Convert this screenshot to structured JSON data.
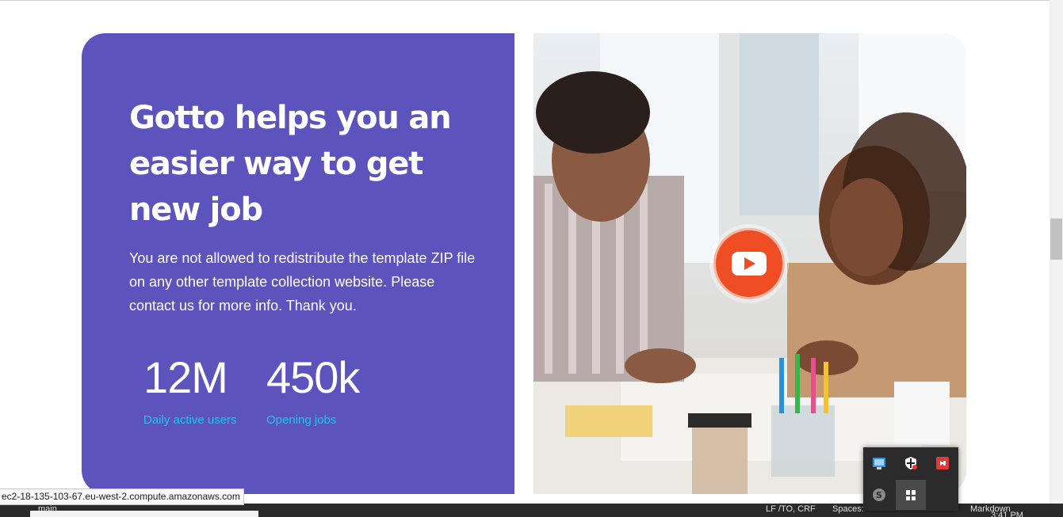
{
  "hero": {
    "title": "Gotto helps you an easier way to get new job",
    "description": "You are not allowed to redistribute the template ZIP file on any other template collection website. Please contact us for more info. Thank you.",
    "stats": [
      {
        "value": "12M",
        "label": "Daily active users"
      },
      {
        "value": "450k",
        "label": "Opening jobs"
      }
    ],
    "background_color": "#5c53bd",
    "stat_label_color": "#1bc6f5"
  },
  "video": {
    "play_icon": "youtube-play-icon",
    "play_color": "#ef4d23"
  },
  "browser": {
    "status_url": "ec2-18-135-103-67.eu-west-2.compute.amazonaws.com"
  },
  "statusbar": {
    "branch": "main",
    "position": "LF  /TO, CRF",
    "spaces": "Spaces:",
    "language": "Markdown",
    "time": "3:41 PM"
  },
  "tray": {
    "icons": [
      "network-monitor-icon",
      "shield-icon",
      "remote-desktop-icon",
      "skype-icon",
      "windows-security-icon"
    ]
  }
}
